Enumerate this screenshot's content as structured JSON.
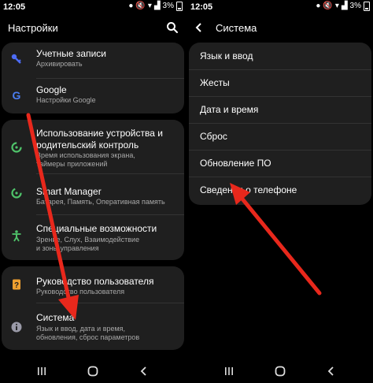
{
  "left": {
    "status": {
      "time": "12:05",
      "battery": "3%"
    },
    "header": {
      "title": "Настройки"
    },
    "cards": [
      {
        "items": [
          {
            "title": "Учетные записи",
            "subtitle": "Архивировать"
          },
          {
            "title": "Google",
            "subtitle": "Настройки Google"
          }
        ]
      },
      {
        "items": [
          {
            "title_line1": "Использование устройства и",
            "title_line2": "родительский контроль",
            "subtitle_line1": "Время использования экрана,",
            "subtitle_line2": "таймеры приложений"
          },
          {
            "title": "Smart Manager",
            "subtitle": "Батарея, Память, Оперативная память"
          },
          {
            "title": "Специальные возможности",
            "subtitle_line1": "Зрение, Слух, Взаимодействие",
            "subtitle_line2": "и зоны управления"
          }
        ]
      },
      {
        "items": [
          {
            "title": "Руководство пользователя",
            "subtitle": "Руководство пользователя"
          },
          {
            "title": "Система",
            "subtitle_line1": "Язык и ввод, дата и время,",
            "subtitle_line2": "обновления, сброс параметров"
          }
        ]
      }
    ]
  },
  "right": {
    "status": {
      "time": "12:05",
      "battery": "3%"
    },
    "header": {
      "title": "Система"
    },
    "items": [
      "Язык и ввод",
      "Жесты",
      "Дата и время",
      "Сброс",
      "Обновление ПО",
      "Сведения о телефоне"
    ]
  },
  "colors": {
    "background": "#000000",
    "card": "#1f1f1f",
    "subtext": "#a8a8a8",
    "arrow": "#e8281c",
    "accounts_icon": "#4d6cf5",
    "google_icon": "#4a7df0",
    "green_icon": "#4fc36a",
    "orange_icon": "#f0a030",
    "gray_icon": "#9a9aa8"
  }
}
